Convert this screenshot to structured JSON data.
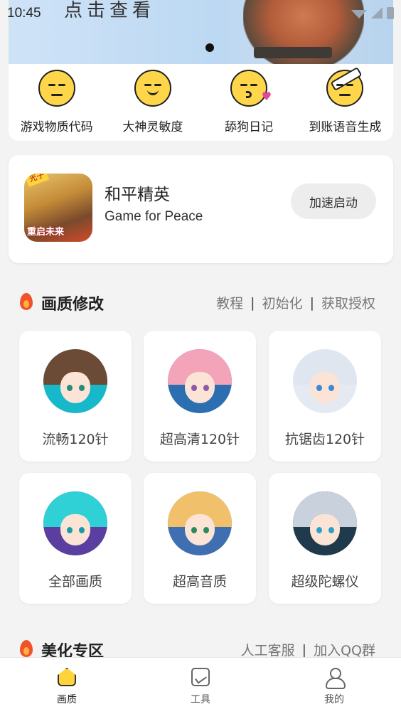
{
  "status_bar": {
    "time": "10:45"
  },
  "banner": {
    "text": "点击查看"
  },
  "quick_tools": [
    {
      "label": "游戏物质代码",
      "icon": "neutral-face-icon"
    },
    {
      "label": "大神灵敏度",
      "icon": "smiling-face-icon"
    },
    {
      "label": "舔狗日记",
      "icon": "kissing-face-icon"
    },
    {
      "label": "到账语音生成",
      "icon": "bandaged-face-icon"
    }
  ],
  "game": {
    "name": "和平精英",
    "english_name": "Game for Peace",
    "logo_tag": "光子",
    "logo_sub": "重启未来",
    "launch_label": "加速启动"
  },
  "quality_section": {
    "title": "画质修改",
    "links": [
      "教程",
      "初始化",
      "获取授权"
    ],
    "separator": "|",
    "tiles": [
      {
        "label": "流畅120针"
      },
      {
        "label": "超高清120针"
      },
      {
        "label": "抗锯齿120针"
      },
      {
        "label": "全部画质"
      },
      {
        "label": "超高音质"
      },
      {
        "label": "超级陀螺仪"
      }
    ]
  },
  "beautify_section": {
    "title": "美化专区",
    "links": [
      "人工客服",
      "加入QQ群"
    ],
    "separator": "|"
  },
  "bottom_nav": [
    {
      "label": "画质",
      "icon": "home-icon",
      "active": true
    },
    {
      "label": "工具",
      "icon": "chart-icon",
      "active": false
    },
    {
      "label": "我的",
      "icon": "user-icon",
      "active": false
    }
  ],
  "colors": {
    "accent": "#ffd43b",
    "flame": "#f0522d",
    "background": "#f3f3f3"
  }
}
